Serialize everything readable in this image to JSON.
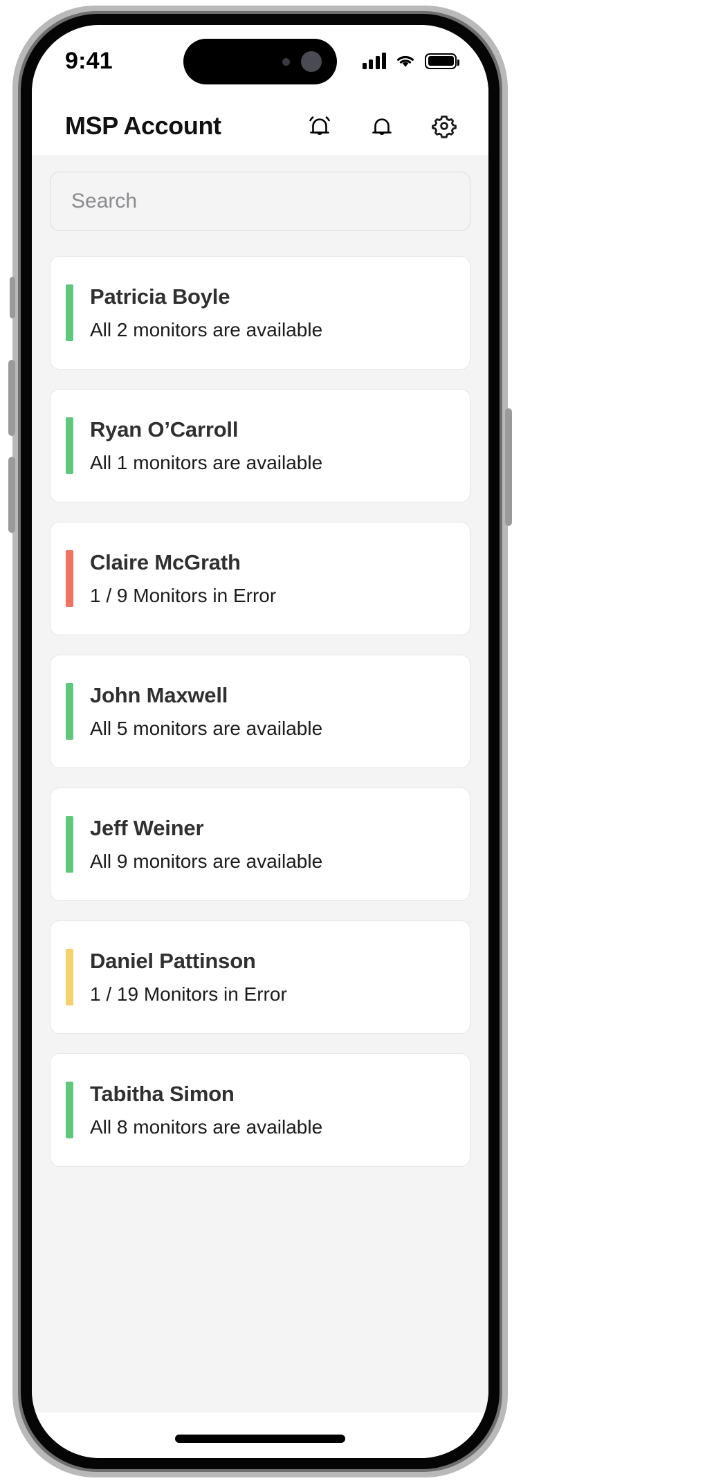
{
  "status_bar": {
    "time": "9:41",
    "cellular_icon": "cellular-signal-icon",
    "wifi_icon": "wifi-icon",
    "battery_icon": "battery-full-icon"
  },
  "header": {
    "title": "MSP Account",
    "actions": [
      {
        "name": "alerts-bell-ringing-icon",
        "label": "Alerts"
      },
      {
        "name": "notifications-bell-icon",
        "label": "Notifications"
      },
      {
        "name": "settings-gear-icon",
        "label": "Settings"
      }
    ]
  },
  "search": {
    "placeholder": "Search",
    "value": ""
  },
  "colors": {
    "available": "#5CC97B",
    "error": "#F4715F",
    "warning": "#FAD06A",
    "page_background": "#F4F4F5",
    "card_background": "#FFFFFF"
  },
  "clients": [
    {
      "name": "Patricia Boyle",
      "status": "All 2 monitors are available",
      "state": "available",
      "accent": "#5CC97B"
    },
    {
      "name": "Ryan O’Carroll",
      "status": "All 1 monitors are available",
      "state": "available",
      "accent": "#5CC97B"
    },
    {
      "name": "Claire McGrath",
      "status": "1 / 9 Monitors in Error",
      "state": "error",
      "accent": "#F4715F"
    },
    {
      "name": "John Maxwell",
      "status": "All 5 monitors are available",
      "state": "available",
      "accent": "#5CC97B"
    },
    {
      "name": "Jeff Weiner",
      "status": "All 9 monitors are available",
      "state": "available",
      "accent": "#5CC97B"
    },
    {
      "name": "Daniel Pattinson",
      "status": "1 / 19 Monitors in Error",
      "state": "warning",
      "accent": "#FAD06A"
    },
    {
      "name": "Tabitha Simon",
      "status": "All 8 monitors are available",
      "state": "available",
      "accent": "#5CC97B"
    }
  ]
}
